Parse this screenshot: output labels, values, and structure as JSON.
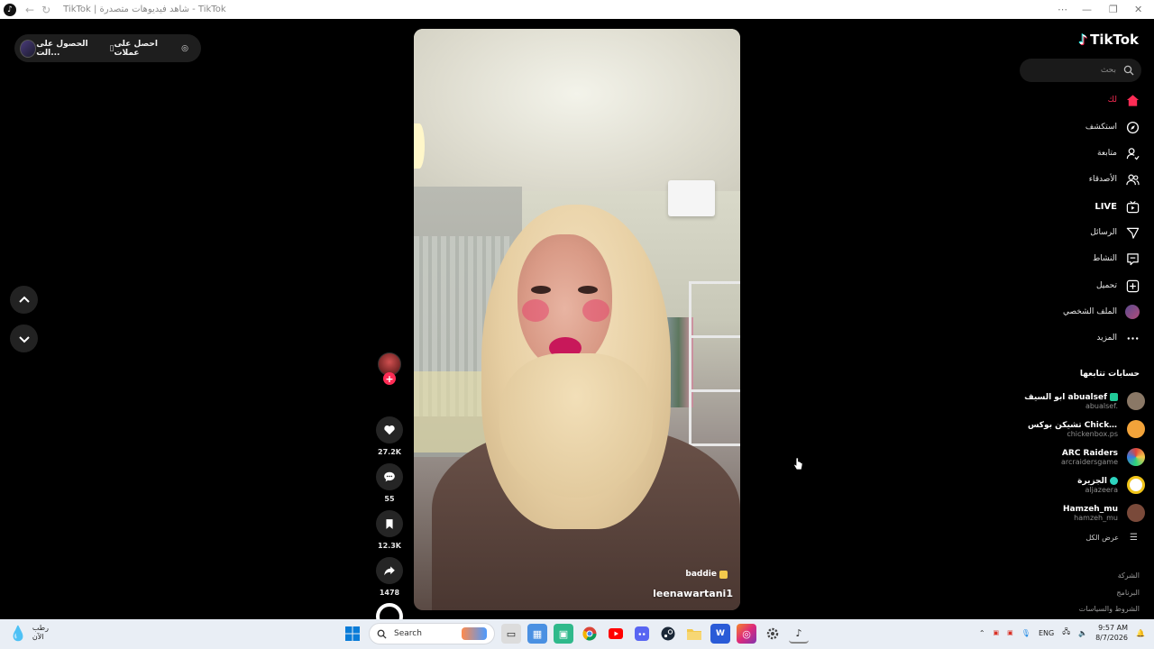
{
  "browser": {
    "title": "TikTok | شاهد فيديوهات متصدرة - TikTok"
  },
  "top_pill": {
    "coins": "احصل على عملات",
    "app": "الحصول على الت..."
  },
  "video": {
    "tag": "baddie",
    "username": "leenawartani1"
  },
  "actions": {
    "likes": "27.2K",
    "comments": "55",
    "saves": "12.3K",
    "shares": "1478"
  },
  "sidebar": {
    "logo": "TikTok",
    "search_placeholder": "بحث",
    "nav": [
      {
        "label": "لك",
        "icon": "home-icon"
      },
      {
        "label": "استكشف",
        "icon": "compass-icon"
      },
      {
        "label": "متابعة",
        "icon": "user-follow-icon"
      },
      {
        "label": "الأصدقاء",
        "icon": "friends-icon"
      },
      {
        "label": "LIVE",
        "icon": "live-icon"
      },
      {
        "label": "الرسائل",
        "icon": "send-icon"
      },
      {
        "label": "النشاط",
        "icon": "activity-icon"
      },
      {
        "label": "تحميل",
        "icon": "upload-icon"
      },
      {
        "label": "الملف الشخصي",
        "icon": "profile-avatar"
      },
      {
        "label": "المزيد",
        "icon": "more-icon"
      }
    ],
    "following_title": "حسابات تتابعها",
    "accounts": [
      {
        "name": "ابو السيف abualsef",
        "handle": "abualsef.",
        "color": "#8a7866"
      },
      {
        "name": "تشيكن بوكس Chicken Box...",
        "handle": "chickenbox.ps",
        "color": "#f2a33a"
      },
      {
        "name": "ARC Raiders",
        "handle": "arcraidersgame",
        "color": "#e0453a"
      },
      {
        "name": "الجزيرة",
        "handle": "aljazeera",
        "color": "#f0c419"
      },
      {
        "name": "Hamzeh_mu",
        "handle": "hamzeh_mu",
        "color": "#7a4a3a"
      }
    ],
    "see_all": "عرض الكل",
    "footer": [
      "الشركة",
      "البرنامج",
      "الشروط والسياسات"
    ]
  },
  "taskbar": {
    "weather_line1": "رطب",
    "weather_line2": "الآن",
    "search": "Search",
    "lang": "ENG",
    "time": "9:57 AM",
    "date": "8/7/2026"
  },
  "colors": {
    "accent": "#fe2c55",
    "sidebar_bg": "#000000",
    "search_bg": "#1a1a1a"
  }
}
